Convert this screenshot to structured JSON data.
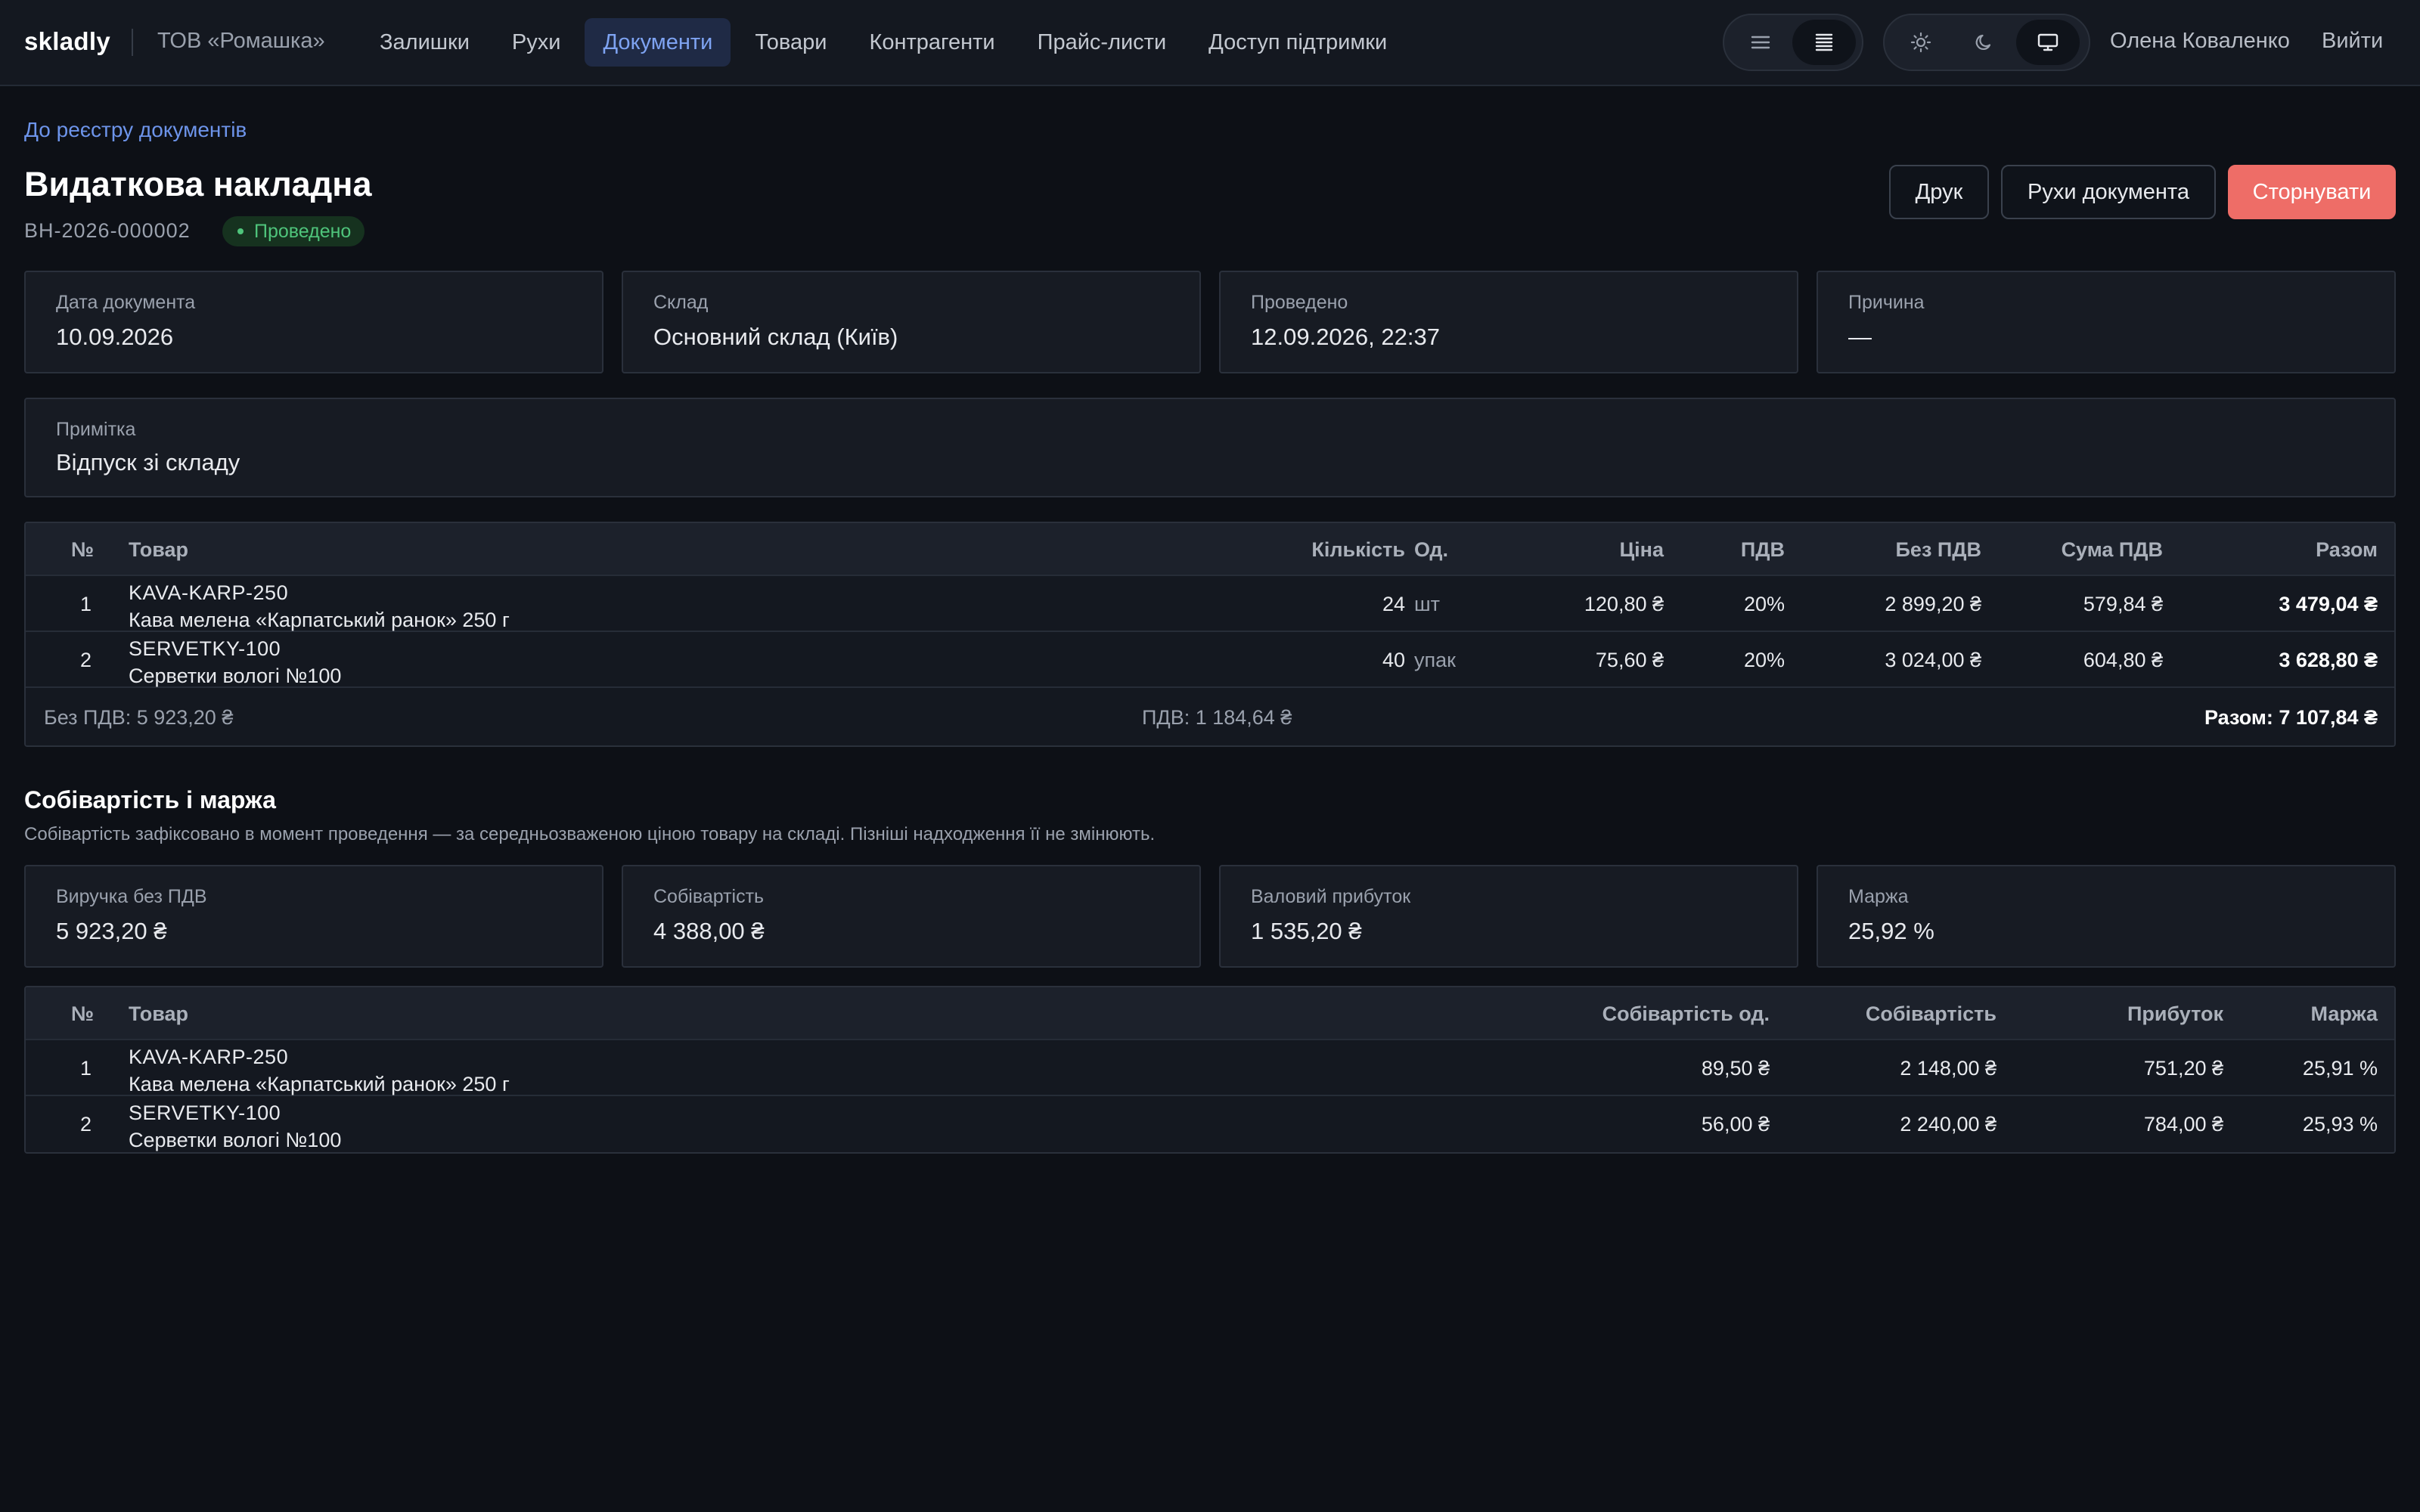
{
  "app": {
    "brand": "skladly",
    "org": "ТОВ «Ромашка»",
    "nav": [
      {
        "label": "Залишки",
        "active": false
      },
      {
        "label": "Рухи",
        "active": false
      },
      {
        "label": "Документи",
        "active": true
      },
      {
        "label": "Товари",
        "active": false
      },
      {
        "label": "Контрагенти",
        "active": false
      },
      {
        "label": "Прайс-листи",
        "active": false
      },
      {
        "label": "Доступ підтримки",
        "active": false
      }
    ],
    "density_toggle": {
      "options": [
        "list-compact-icon",
        "list-dense-icon"
      ],
      "selected": "list-dense-icon"
    },
    "theme_toggle": {
      "options": [
        "sun-icon",
        "moon-icon",
        "monitor-icon"
      ],
      "selected": "monitor-icon"
    },
    "user": "Олена Коваленко",
    "logout": "Вийти"
  },
  "page": {
    "back_link": "До реєстру документів",
    "title": "Видаткова накладна",
    "doc_number": "ВН-2026-000002",
    "status": "Проведено",
    "actions": {
      "print": "Друк",
      "movements": "Рухи документа",
      "reverse": "Сторнувати"
    }
  },
  "info_cards": [
    {
      "label": "Дата документа",
      "value": "10.09.2026"
    },
    {
      "label": "Склад",
      "value": "Основний склад (Київ)"
    },
    {
      "label": "Проведено",
      "value": "12.09.2026, 22:37"
    },
    {
      "label": "Причина",
      "value": "—"
    }
  ],
  "note": {
    "label": "Примітка",
    "value": "Відпуск зі складу"
  },
  "items_table": {
    "headers": {
      "no": "№",
      "product": "Товар",
      "qty": "Кількість",
      "unit": "Од.",
      "price": "Ціна",
      "vat": "ПДВ",
      "net": "Без ПДВ",
      "vat_sum": "Сума ПДВ",
      "total": "Разом"
    },
    "rows": [
      {
        "no": "1",
        "sku": "KAVA-KARP-250",
        "name": "Кава мелена «Карпатський ранок» 250 г",
        "qty": "24",
        "unit": "шт",
        "price": "120,80 ₴",
        "vat": "20%",
        "net": "2 899,20 ₴",
        "vat_sum": "579,84 ₴",
        "total": "3 479,04 ₴"
      },
      {
        "no": "2",
        "sku": "SERVETKY-100",
        "name": "Серветки вологі №100",
        "qty": "40",
        "unit": "упак",
        "price": "75,60 ₴",
        "vat": "20%",
        "net": "3 024,00 ₴",
        "vat_sum": "604,80 ₴",
        "total": "3 628,80 ₴"
      }
    ],
    "footer": {
      "net": "Без ПДВ: 5 923,20 ₴",
      "vat": "ПДВ: 1 184,64 ₴",
      "total": "Разом: 7 107,84 ₴"
    }
  },
  "cost_section": {
    "title": "Собівартість і маржа",
    "subtitle": "Собівартість зафіксовано в момент проведення — за середньозваженою ціною товару на складі. Пізніші надходження її не змінюють.",
    "cards": [
      {
        "label": "Виручка без ПДВ",
        "value": "5 923,20 ₴"
      },
      {
        "label": "Собівартість",
        "value": "4 388,00 ₴"
      },
      {
        "label": "Валовий прибуток",
        "value": "1 535,20 ₴"
      },
      {
        "label": "Маржа",
        "value": "25,92 %"
      }
    ],
    "table": {
      "headers": {
        "no": "№",
        "product": "Товар",
        "unit_cost": "Собівартість од.",
        "cost": "Собівартість",
        "profit": "Прибуток",
        "margin": "Маржа"
      },
      "rows": [
        {
          "no": "1",
          "sku": "KAVA-KARP-250",
          "name": "Кава мелена «Карпатський ранок» 250 г",
          "unit_cost": "89,50 ₴",
          "cost": "2 148,00 ₴",
          "profit": "751,20 ₴",
          "margin": "25,91 %"
        },
        {
          "no": "2",
          "sku": "SERVETKY-100",
          "name": "Серветки вологі №100",
          "unit_cost": "56,00 ₴",
          "cost": "2 240,00 ₴",
          "profit": "784,00 ₴",
          "margin": "25,93 %"
        }
      ]
    }
  }
}
